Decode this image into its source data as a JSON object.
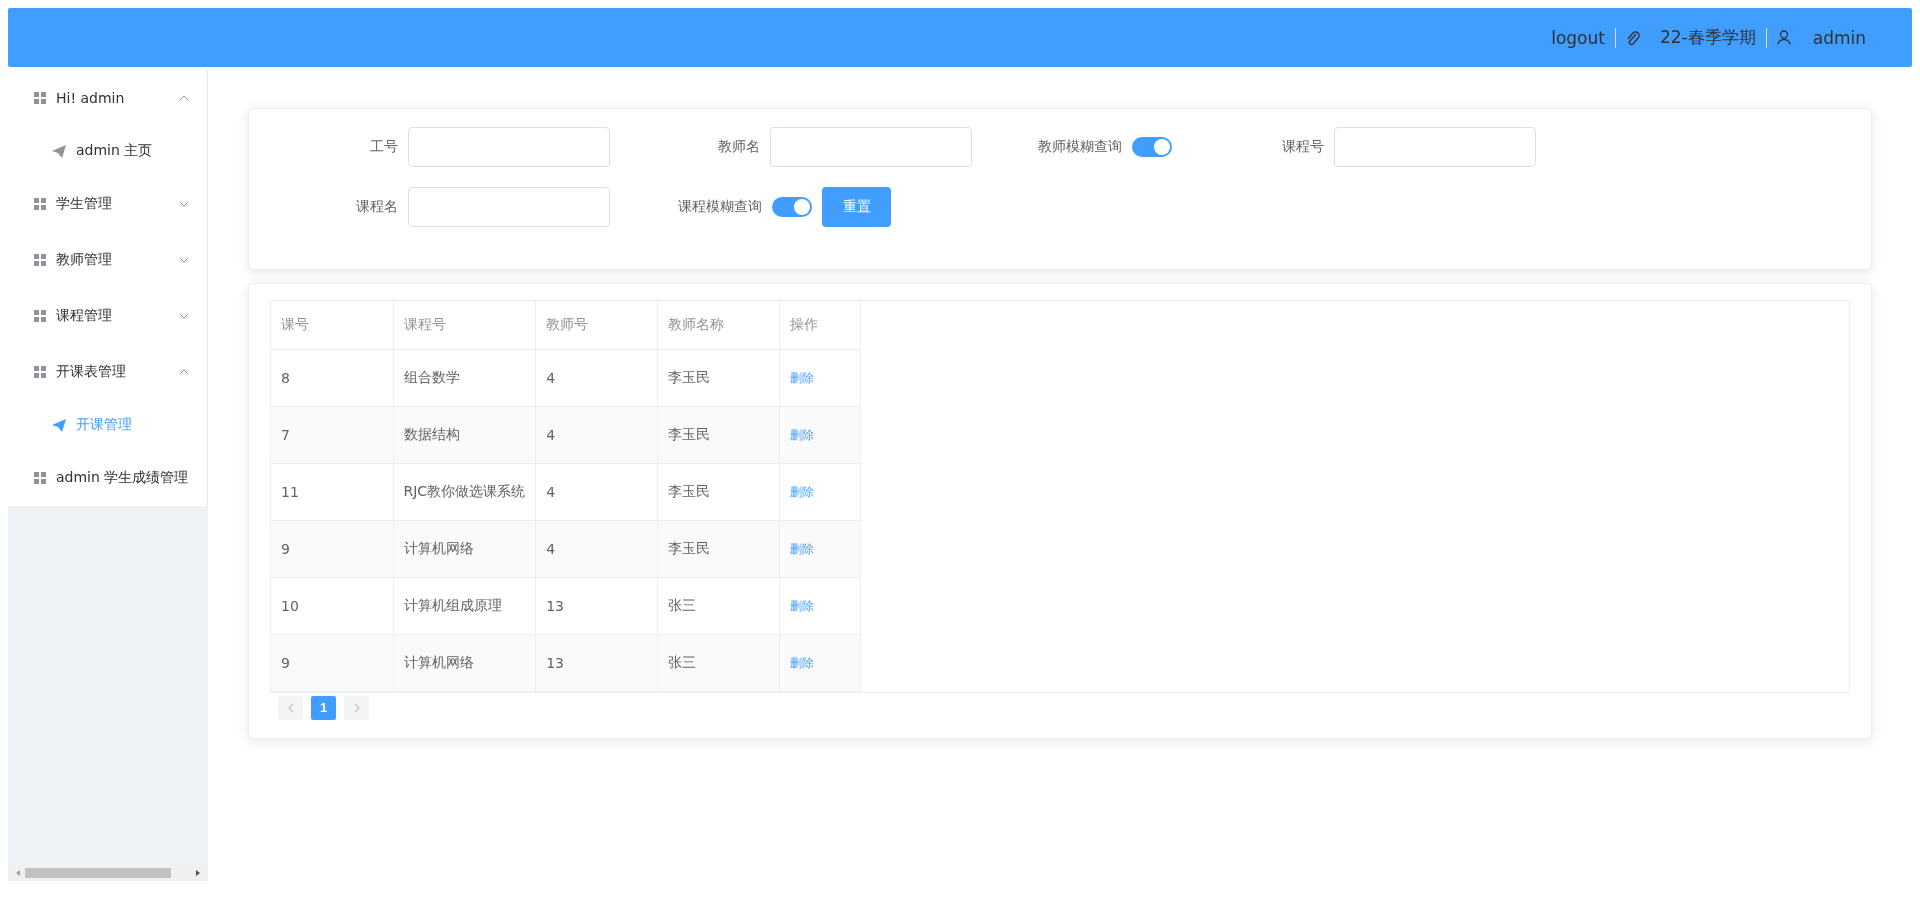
{
  "header": {
    "logout": "logout",
    "term": "22-春季学期",
    "user": "admin"
  },
  "sidebar": {
    "items": [
      {
        "label": "Hi! admin",
        "expanded": true,
        "children": [
          {
            "label": "admin 主页",
            "selected": false
          }
        ]
      },
      {
        "label": "学生管理",
        "expanded": false
      },
      {
        "label": "教师管理",
        "expanded": false
      },
      {
        "label": "课程管理",
        "expanded": false
      },
      {
        "label": "开课表管理",
        "expanded": true,
        "children": [
          {
            "label": "开课管理",
            "selected": true
          }
        ]
      },
      {
        "label": "admin 学生成绩管理"
      }
    ]
  },
  "filter": {
    "rows": [
      [
        {
          "kind": "input",
          "label": "工号"
        },
        {
          "kind": "input",
          "label": "教师名"
        },
        {
          "kind": "switch",
          "label": "教师模糊查询",
          "on": true
        },
        {
          "kind": "input",
          "label": "课程号"
        }
      ],
      [
        {
          "kind": "input",
          "label": "课程名"
        },
        {
          "kind": "switch",
          "label": "课程模糊查询",
          "on": true,
          "button": "重置"
        }
      ]
    ]
  },
  "table": {
    "columns": [
      "课号",
      "课程号",
      "教师号",
      "教师名称",
      "操作"
    ],
    "rows": [
      {
        "cells": [
          "8",
          "组合数学",
          "4",
          "李玉民"
        ],
        "action": "删除"
      },
      {
        "cells": [
          "7",
          "数据结构",
          "4",
          "李玉民"
        ],
        "action": "删除"
      },
      {
        "cells": [
          "11",
          "RJC教你做选课系统",
          "4",
          "李玉民"
        ],
        "action": "删除"
      },
      {
        "cells": [
          "9",
          "计算机网络",
          "4",
          "李玉民"
        ],
        "action": "删除"
      },
      {
        "cells": [
          "10",
          "计算机组成原理",
          "13",
          "张三"
        ],
        "action": "删除"
      },
      {
        "cells": [
          "9",
          "计算机网络",
          "13",
          "张三"
        ],
        "action": "删除"
      }
    ]
  },
  "pagination": {
    "prev_disabled": true,
    "pages": [
      {
        "label": "1",
        "selected": true
      }
    ],
    "next_disabled": true
  }
}
